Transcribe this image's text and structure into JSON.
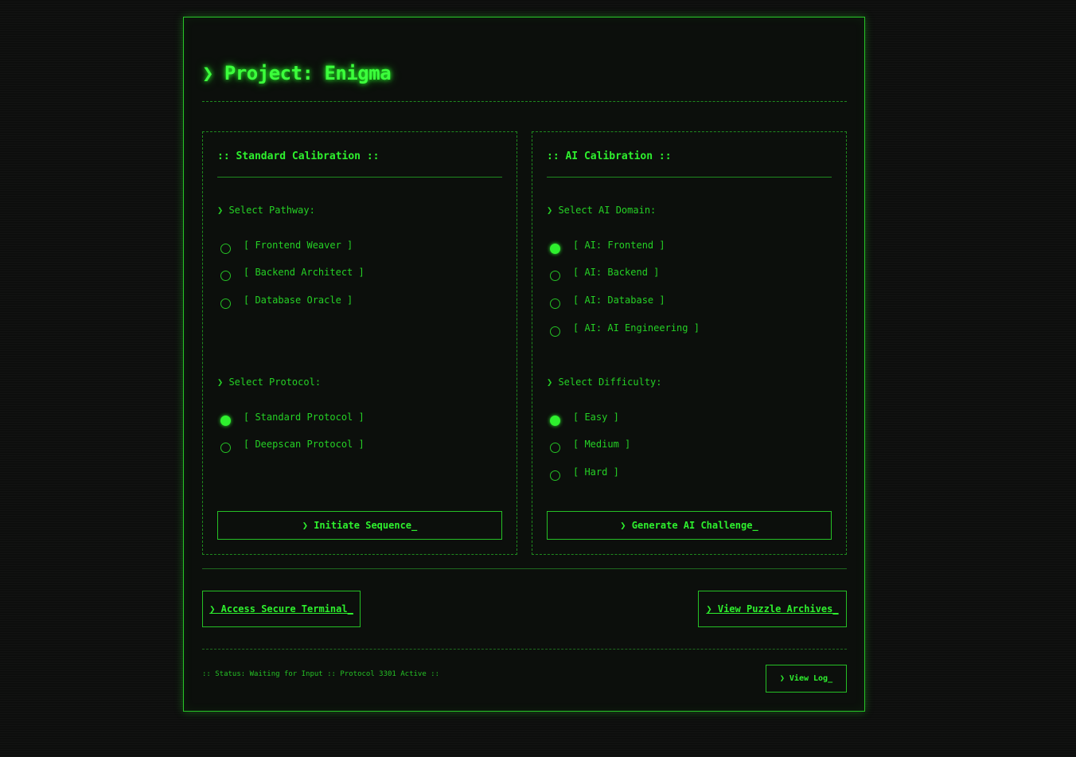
{
  "title": "❯ Project: Enigma",
  "standard": {
    "title": ":: Standard Calibration ::",
    "pathway_label": "❯ Select Pathway:",
    "pathways": [
      {
        "label": "[ Frontend Weaver ]",
        "selected": false
      },
      {
        "label": "[ Backend Architect ]",
        "selected": false
      },
      {
        "label": "[ Database Oracle ]",
        "selected": false
      }
    ],
    "protocol_label": "❯ Select Protocol:",
    "protocols": [
      {
        "label": "[ Standard Protocol ]",
        "selected": true
      },
      {
        "label": "[ Deepscan Protocol ]",
        "selected": false
      }
    ],
    "button": "❯ Initiate Sequence_"
  },
  "ai": {
    "title": ":: AI Calibration ::",
    "domain_label": "❯ Select AI Domain:",
    "domains": [
      {
        "label": "[ AI: Frontend ]",
        "selected": true
      },
      {
        "label": "[ AI: Backend ]",
        "selected": false
      },
      {
        "label": "[ AI: Database ]",
        "selected": false
      },
      {
        "label": "[ AI: AI Engineering ]",
        "selected": false
      }
    ],
    "difficulty_label": "❯ Select Difficulty:",
    "difficulties": [
      {
        "label": "[ Easy ]",
        "selected": true
      },
      {
        "label": "[ Medium ]",
        "selected": false
      },
      {
        "label": "[ Hard ]",
        "selected": false
      }
    ],
    "button": "❯ Generate AI Challenge_"
  },
  "links": {
    "terminal": "❯ Access Secure Terminal_",
    "archives": "❯ View Puzzle Archives_"
  },
  "footer": {
    "status": ":: Status: Waiting for Input :: Protocol 3301 Active ::",
    "log_button": "❯ View Log_"
  },
  "colors": {
    "accent": "#2ef02e",
    "background": "#0d0e0d",
    "border": "#25c025"
  }
}
